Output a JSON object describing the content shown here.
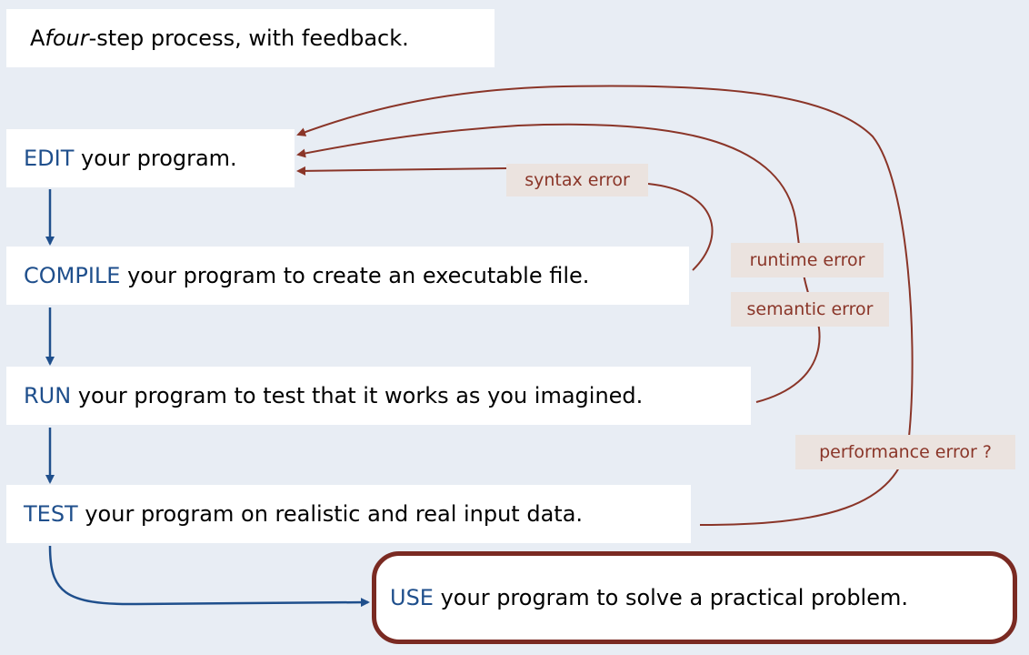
{
  "title": {
    "pre": "A ",
    "em": "four",
    "post": "-step process, with feedback."
  },
  "steps": {
    "edit": {
      "keyword": "EDIT",
      "text": " your program."
    },
    "compile": {
      "keyword": "COMPILE",
      "text": " your program to create an executable file."
    },
    "run": {
      "keyword": "RUN",
      "text": " your program to test that it works as you imagined."
    },
    "test": {
      "keyword": "TEST",
      "text": " your program on realistic and real input data."
    },
    "use": {
      "keyword": "USE",
      "text": " your program to solve a practical problem."
    }
  },
  "errors": {
    "syntax": "syntax error",
    "runtime": "runtime error",
    "semantic": "semantic error",
    "performance": "performance error ?"
  },
  "colors": {
    "step_keyword": "#1f4f8c",
    "feedback": "#8a3528",
    "flow": "#1f4f8c",
    "use_border": "#7a2a22"
  }
}
